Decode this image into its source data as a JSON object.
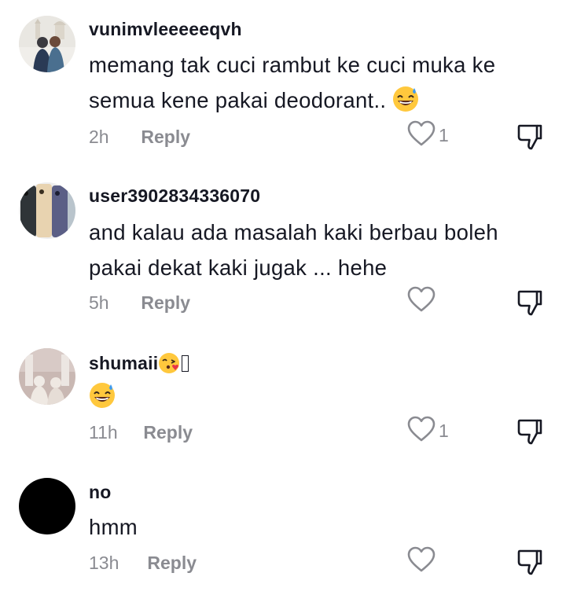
{
  "comments": [
    {
      "username": "vunimvleeeeeqvh",
      "text": "memang tak cuci rambut ke cuci muka ke semua kene pakai deodorant..",
      "emoji": "grinning-sweat-emoji",
      "time": "2h",
      "reply_label": "Reply",
      "likes": "1"
    },
    {
      "username": "user3902834336070",
      "text": "and kalau ada masalah kaki berbau boleh pakai dekat kaki jugak ... hehe",
      "time": "5h",
      "reply_label": "Reply",
      "likes": ""
    },
    {
      "username": "shumaii",
      "username_emoji": "kissing-heart-emoji",
      "emoji": "grinning-sweat-emoji",
      "time": "11h",
      "reply_label": "Reply",
      "likes": "1"
    },
    {
      "username": "no",
      "text": "hmm",
      "time": "13h",
      "reply_label": "Reply",
      "likes": ""
    }
  ],
  "colors": {
    "primary_text": "#161823",
    "secondary_text": "#8a8b91",
    "emoji_yellow": "#ffc83d",
    "sweat_blue": "#3e9bf0"
  },
  "icons": {
    "like": "heart-outline-icon",
    "dislike": "thumbs-down-outline-icon"
  }
}
